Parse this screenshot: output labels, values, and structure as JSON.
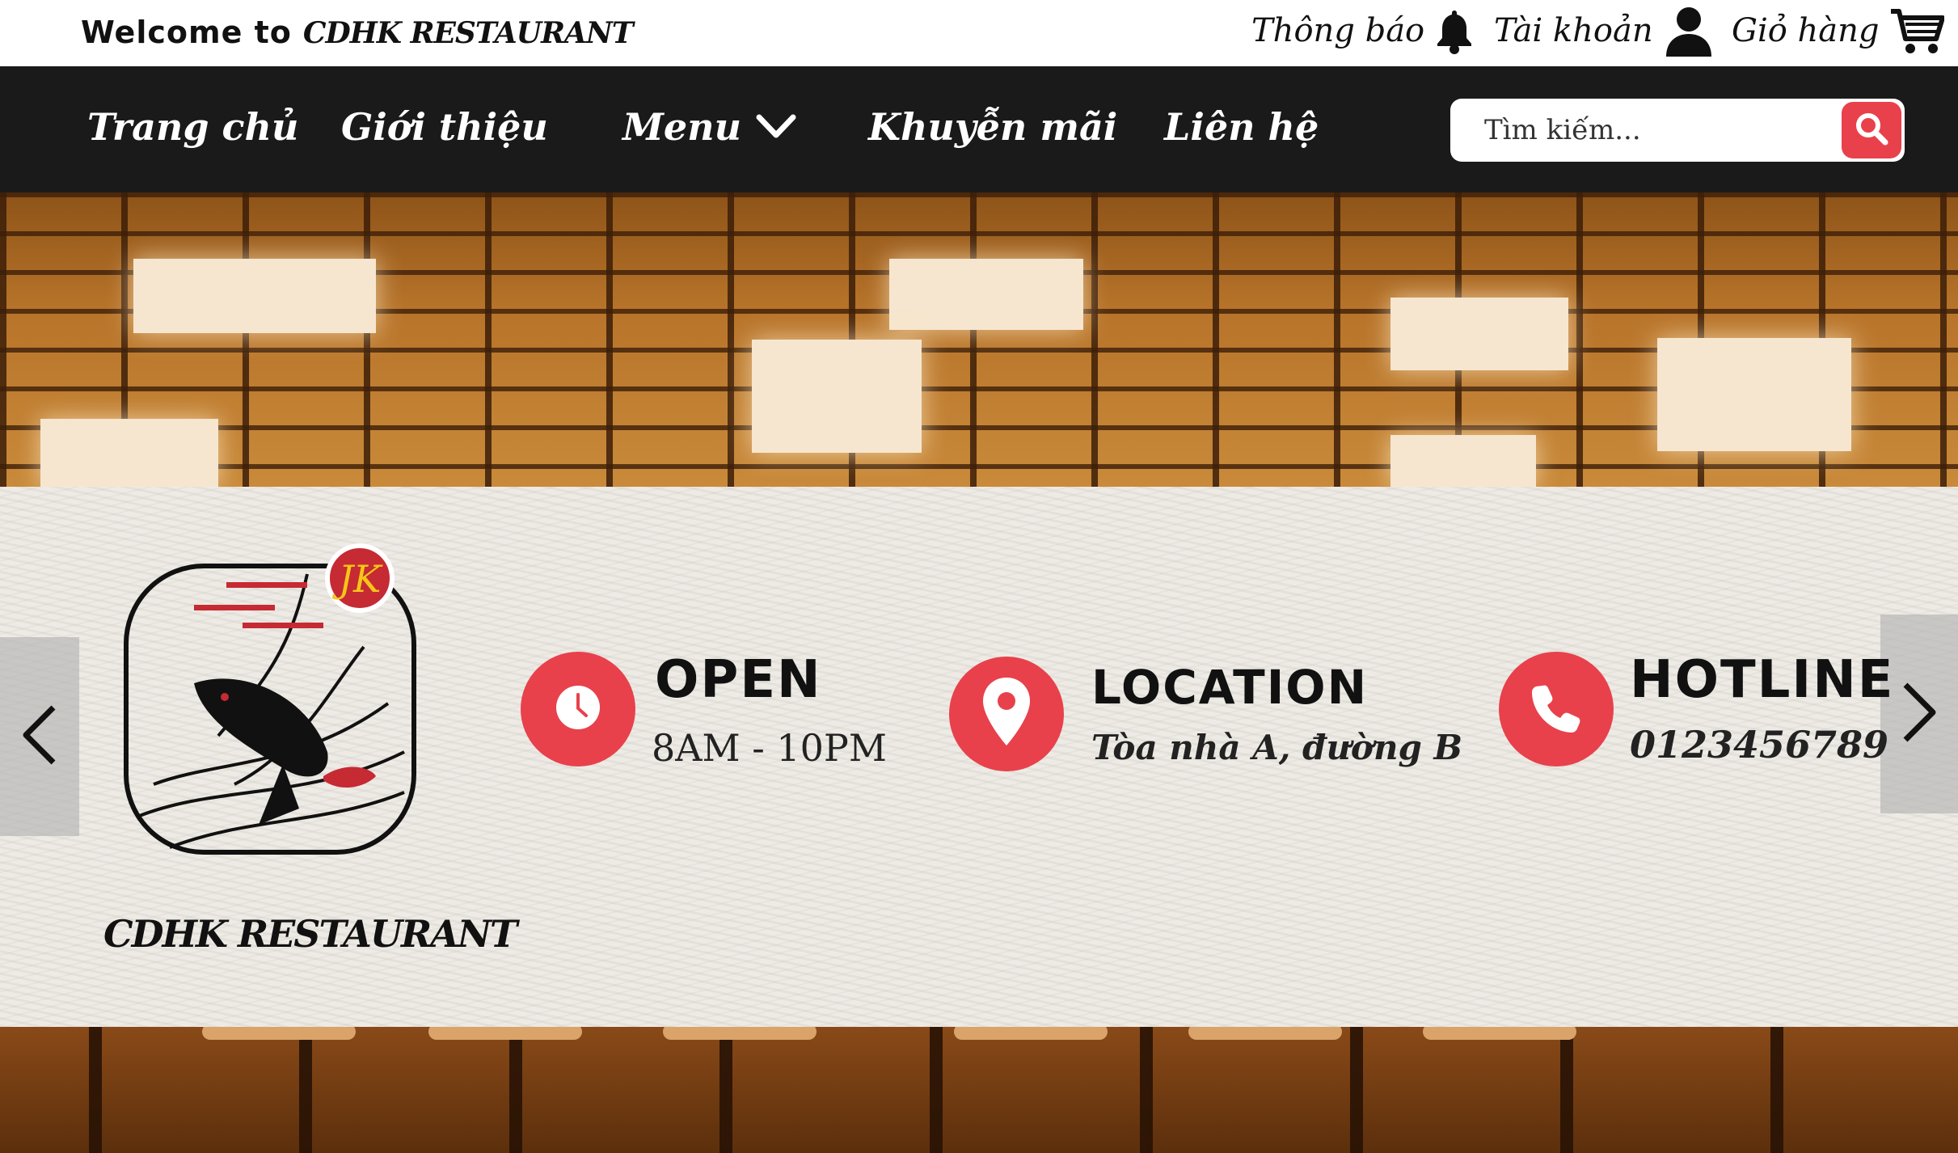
{
  "topbar": {
    "welcome_prefix": "Welcome to",
    "brand": "CDHK RESTAURANT",
    "links": [
      {
        "label": "Thông báo",
        "icon": "bell-icon"
      },
      {
        "label": "Tài khoản",
        "icon": "user-icon"
      },
      {
        "label": "Giỏ hàng",
        "icon": "cart-icon"
      }
    ]
  },
  "nav": {
    "items": [
      {
        "label": "Trang chủ"
      },
      {
        "label": "Giới thiệu"
      },
      {
        "label": "Menu",
        "icon": "chevron-down-icon"
      },
      {
        "label": "Khuyễn mãi"
      },
      {
        "label": "Liên hệ"
      }
    ],
    "search": {
      "placeholder": "Tìm kiếm...",
      "value": "",
      "icon": "search-icon"
    }
  },
  "hero": {
    "logo_name": "CDHK RESTAURANT",
    "info": [
      {
        "title": "OPEN",
        "value": "8AM - 10PM",
        "icon": "clock-icon"
      },
      {
        "title": "LOCATION",
        "value": "Tòa nhà A, đường B",
        "icon": "map-pin-icon"
      },
      {
        "title": "HOTLINE",
        "value": "0123456789",
        "icon": "phone-icon"
      }
    ],
    "arrows": {
      "prev_icon": "chevron-left-icon",
      "next_icon": "chevron-right-icon"
    }
  },
  "colors": {
    "accent": "#e8414b",
    "navbar": "#1a1a1a",
    "band": "#eeebe6"
  }
}
